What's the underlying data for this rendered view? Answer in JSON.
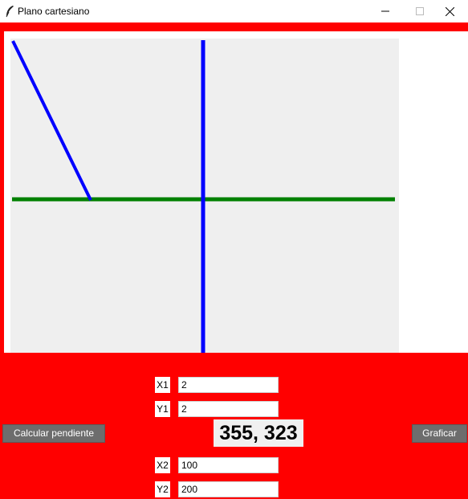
{
  "window": {
    "title": "Plano cartesiano",
    "icons": {
      "app": "feather-icon",
      "minimize": "minimize-icon",
      "maximize": "maximize-icon",
      "close": "close-icon"
    }
  },
  "colors": {
    "frame_red": "#ff0000",
    "canvas_bg": "#efefef",
    "axis_vertical": "#0000ff",
    "axis_horizontal": "#008000",
    "plotted_line": "#0000ff",
    "button_bg": "#6d6d6d"
  },
  "inputs": {
    "x1": {
      "label": "X1",
      "value": "2"
    },
    "y1": {
      "label": "Y1",
      "value": "2"
    },
    "x2": {
      "label": "X2",
      "value": "100"
    },
    "y2": {
      "label": "Y2",
      "value": "200"
    }
  },
  "coords_display": "355, 323",
  "buttons": {
    "slope": "Calcular pendiente",
    "plot": "Graficar"
  }
}
